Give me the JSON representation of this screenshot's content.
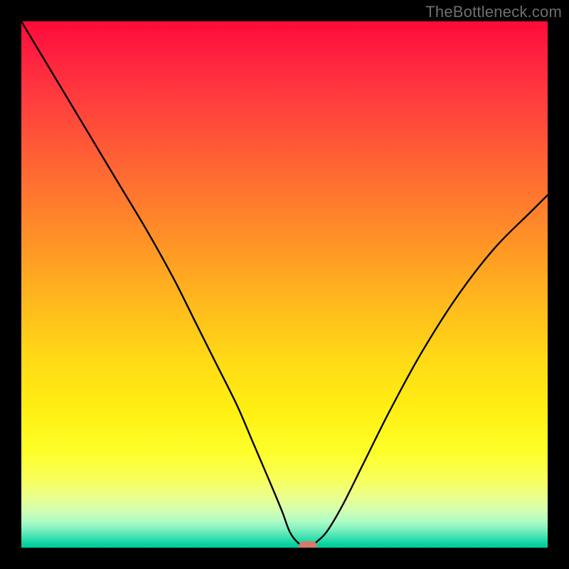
{
  "attribution": "TheBottleneck.com",
  "chart_data": {
    "type": "line",
    "title": "",
    "xlabel": "",
    "ylabel": "",
    "xlim": [
      0,
      100
    ],
    "ylim": [
      0,
      100
    ],
    "series": [
      {
        "name": "bottleneck-curve",
        "x": [
          0,
          6,
          12,
          18,
          24,
          29,
          33,
          37,
          41,
          44,
          47,
          49.5,
          51,
          52.5,
          54,
          55,
          56,
          58,
          61,
          65,
          70,
          76,
          83,
          90,
          97,
          100
        ],
        "values": [
          100,
          90,
          80,
          70,
          60,
          51,
          43,
          35,
          27,
          20,
          13,
          7,
          3,
          1,
          0,
          0,
          1,
          3,
          8,
          16,
          26,
          37,
          48,
          57,
          64,
          67
        ]
      }
    ],
    "marker": {
      "x": 54.5,
      "y": 0.3
    },
    "gradient_stops": [
      {
        "pct": 0,
        "color": "#ff0a3a"
      },
      {
        "pct": 50,
        "color": "#ffbb1c"
      },
      {
        "pct": 85,
        "color": "#fdff2a"
      },
      {
        "pct": 100,
        "color": "#00cf9e"
      }
    ]
  }
}
